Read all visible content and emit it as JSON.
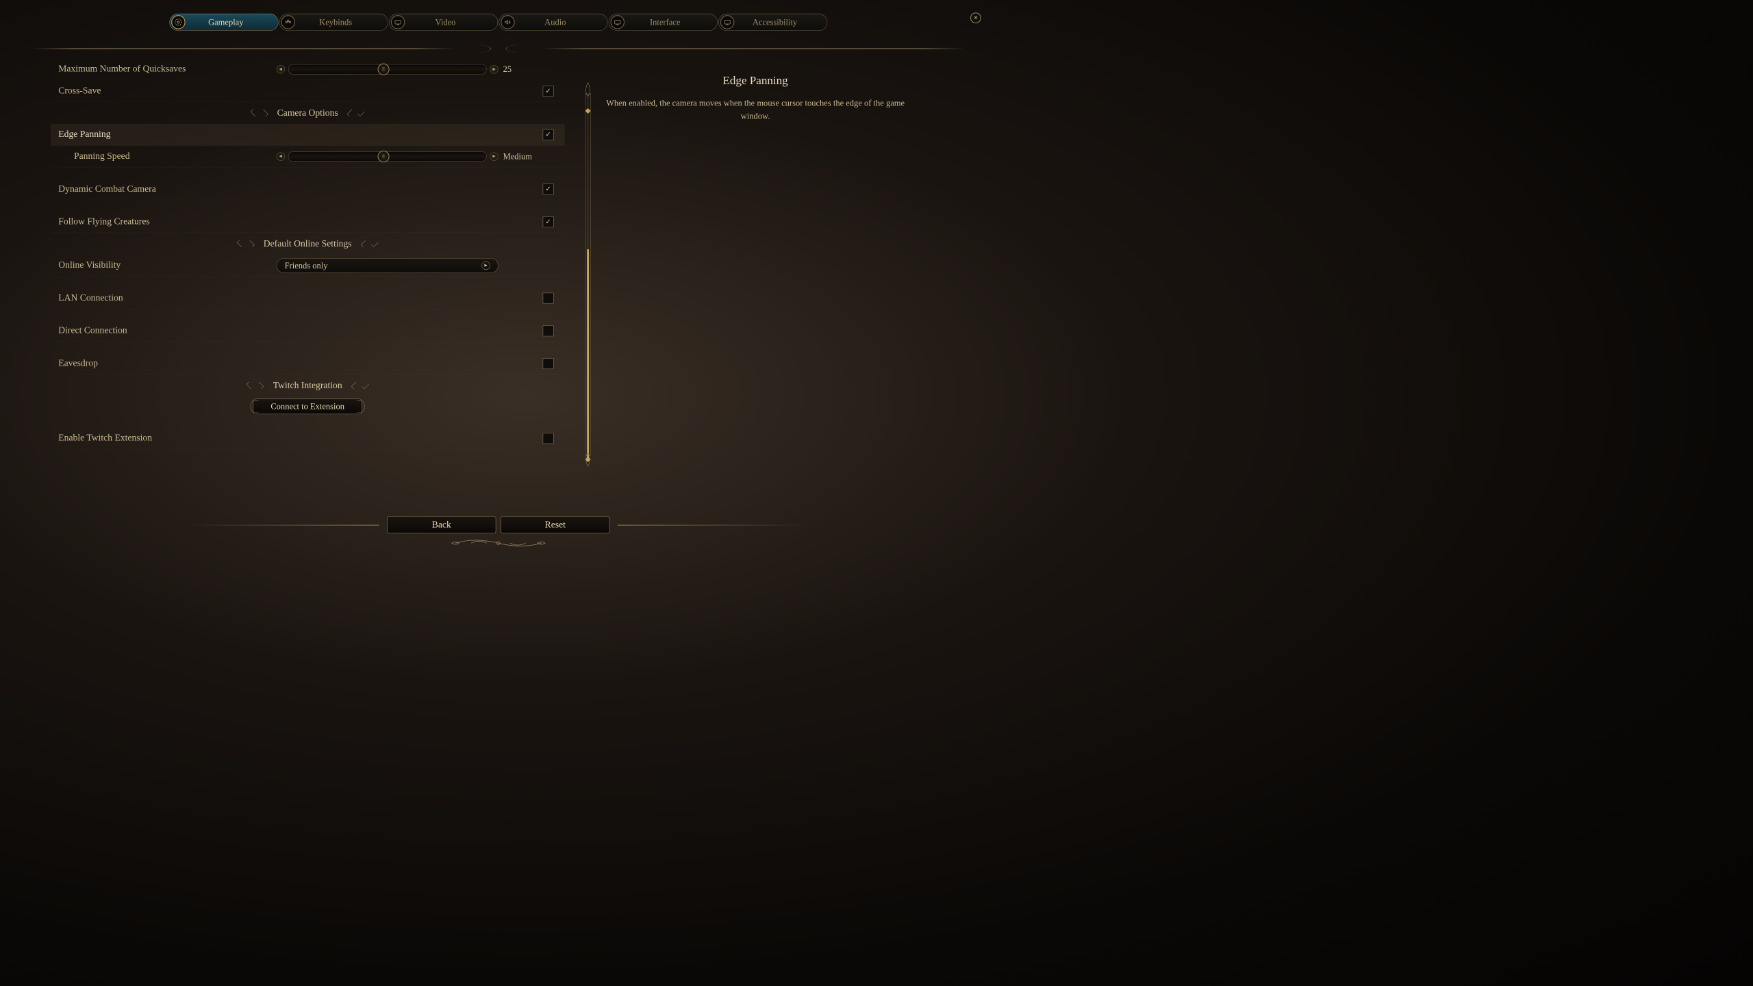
{
  "tabs": [
    {
      "label": "Gameplay",
      "active": true
    },
    {
      "label": "Keybinds",
      "active": false
    },
    {
      "label": "Video",
      "active": false
    },
    {
      "label": "Audio",
      "active": false
    },
    {
      "label": "Interface",
      "active": false
    },
    {
      "label": "Accessibility",
      "active": false
    }
  ],
  "settings": {
    "quicksaves": {
      "label": "Maximum Number of Quicksaves",
      "value": "25",
      "pos": 48
    },
    "crossSave": {
      "label": "Cross-Save",
      "checked": true
    },
    "section_camera": "Camera Options",
    "edgePanning": {
      "label": "Edge Panning",
      "checked": true
    },
    "panningSpeed": {
      "label": "Panning Speed",
      "value": "Medium",
      "pos": 48
    },
    "dynamicCombat": {
      "label": "Dynamic Combat Camera",
      "checked": true
    },
    "followFlying": {
      "label": "Follow Flying Creatures",
      "checked": true
    },
    "section_online": "Default Online Settings",
    "onlineVisibility": {
      "label": "Online Visibility",
      "value": "Friends only"
    },
    "lanConnection": {
      "label": "LAN Connection",
      "checked": false
    },
    "directConnection": {
      "label": "Direct Connection",
      "checked": false
    },
    "eavesdrop": {
      "label": "Eavesdrop",
      "checked": false
    },
    "section_twitch": "Twitch Integration",
    "connectExtension": "Connect to Extension",
    "enableTwitch": {
      "label": "Enable Twitch Extension",
      "checked": false
    }
  },
  "description": {
    "title": "Edge Panning",
    "text": "When enabled, the camera moves when the mouse cursor touches the edge of the game window."
  },
  "buttons": {
    "back": "Back",
    "reset": "Reset"
  }
}
